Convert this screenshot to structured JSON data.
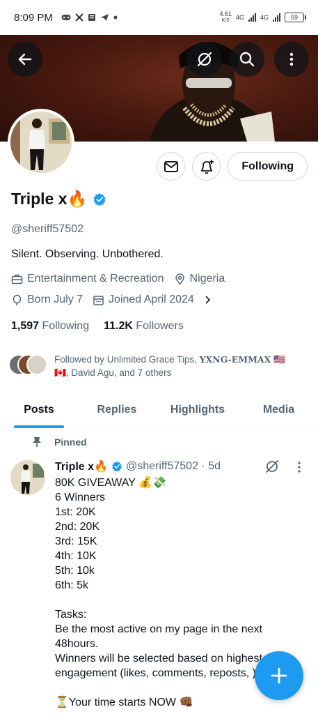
{
  "status_bar": {
    "time": "8:09 PM",
    "net_speed": "4.61",
    "net_unit": "K/S",
    "sim1": "4G",
    "sim2": "4G",
    "battery": "59"
  },
  "header": {
    "back_icon": "arrow-left-icon",
    "grok_icon": "grok-icon",
    "search_icon": "search-icon",
    "more_icon": "more-vertical-icon"
  },
  "profile": {
    "follow_button": "Following",
    "name": "Triple x",
    "name_emoji": "🔥",
    "handle": "@sheriff57502",
    "bio": "Silent. Observing. Unbothered.",
    "category": "Entertainment & Recreation",
    "location": "Nigeria",
    "born": "Born July 7",
    "joined": "Joined April 2024",
    "following_count": "1,597",
    "following_label": "Following",
    "followers_count": "11.2K",
    "followers_label": "Followers",
    "followed_by_prefix": "Followed by Unlimited Grace Tips, ",
    "followed_by_bold": "YXNG-EMMAX",
    "followed_by_suffix": " 🇺🇸 🇨🇦, David Agu, and 7 others"
  },
  "tabs": [
    {
      "label": "Posts",
      "active": true
    },
    {
      "label": "Replies",
      "active": false
    },
    {
      "label": "Highlights",
      "active": false
    },
    {
      "label": "Media",
      "active": false
    }
  ],
  "pinned_post": {
    "pinned_label": "Pinned",
    "author_name": "Triple x",
    "author_emoji": "🔥",
    "meta": "@sheriff57502 · 5d",
    "text": "80K GIVEAWAY 💰💸\n6 Winners\n1st: 20K\n2nd: 20K\n3rd: 15K\n4th: 10K\n5th: 10k\n6th: 5k\n\nTasks:\nBe the most active on my page in the next 48hours.\nWinners will be selected based on highest engagement (likes, comments, reposts, )\n\n⏳Your time starts NOW 👊🏾"
  },
  "colors": {
    "accent": "#1d9bf0",
    "text_primary": "#0f1419",
    "text_secondary": "#536471"
  }
}
